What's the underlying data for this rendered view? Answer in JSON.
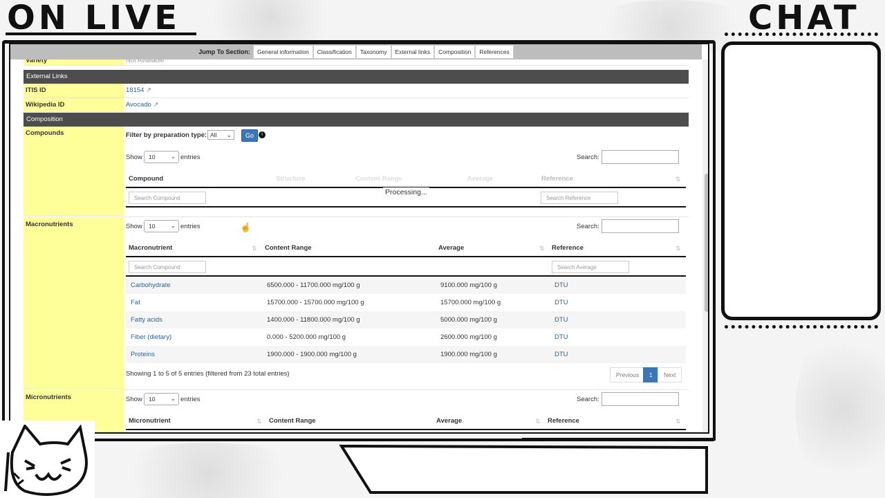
{
  "overlay": {
    "on_live": "ON LIVE",
    "chat": "CHAT"
  },
  "jump": {
    "label": "Jump To Section:",
    "tabs": [
      "General information",
      "Classification",
      "Taxonomy",
      "External links",
      "Composition",
      "References"
    ]
  },
  "variety_row": {
    "label": "Variety",
    "value": "Not Available"
  },
  "external_links_section": "External Links",
  "itis": {
    "label": "ITIS ID",
    "value": "18154"
  },
  "wikipedia": {
    "label": "Wikipedia ID",
    "value": "Avocado"
  },
  "composition_section": "Composition",
  "compounds": {
    "label": "Compounds",
    "filter_label": "Filter by preparation type:",
    "filter_value": "All",
    "go": "Go",
    "show": "Show",
    "entries_value": "10",
    "entries": "entries",
    "search": "Search:",
    "headers": [
      "Compound",
      "Structure",
      "Content Range",
      "Average",
      "Reference"
    ],
    "processing": "Processing...",
    "search_compound_ph": "Search Compound",
    "search_reference_ph": "Search Reference"
  },
  "macro": {
    "label": "Macronutrients",
    "show": "Show",
    "entries_value": "10",
    "entries": "entries",
    "search": "Search:",
    "headers": [
      "Macronutrient",
      "Content Range",
      "Average",
      "Reference"
    ],
    "search_compound_ph": "Search Compound",
    "search_average_ph": "Search Average",
    "rows": [
      {
        "name": "Carbohydrate",
        "range": "6500.000 - 11700.000 mg/100 g",
        "avg": "9100.000 mg/100 g",
        "ref": "DTU"
      },
      {
        "name": "Fat",
        "range": "15700.000 - 15700.000 mg/100 g",
        "avg": "15700.000 mg/100 g",
        "ref": "DTU"
      },
      {
        "name": "Fatty acids",
        "range": "1400.000 - 11800.000 mg/100 g",
        "avg": "5000.000 mg/100 g",
        "ref": "DTU"
      },
      {
        "name": "Fiber (dietary)",
        "range": "0.000 - 5200.000 mg/100 g",
        "avg": "2600.000 mg/100 g",
        "ref": "DTU"
      },
      {
        "name": "Proteins",
        "range": "1900.000 - 1900.000 mg/100 g",
        "avg": "1900.000 mg/100 g",
        "ref": "DTU"
      }
    ],
    "info": "Showing 1 to 5 of 5 entries (filtered from 23 total entries)",
    "prev": "Previous",
    "page": "1",
    "next": "Next"
  },
  "micro": {
    "label": "Micronutrients",
    "show": "Show",
    "entries_value": "10",
    "entries": "entries",
    "search": "Search:",
    "headers": [
      "Micronutrient",
      "Content Range",
      "Average",
      "Reference"
    ]
  }
}
